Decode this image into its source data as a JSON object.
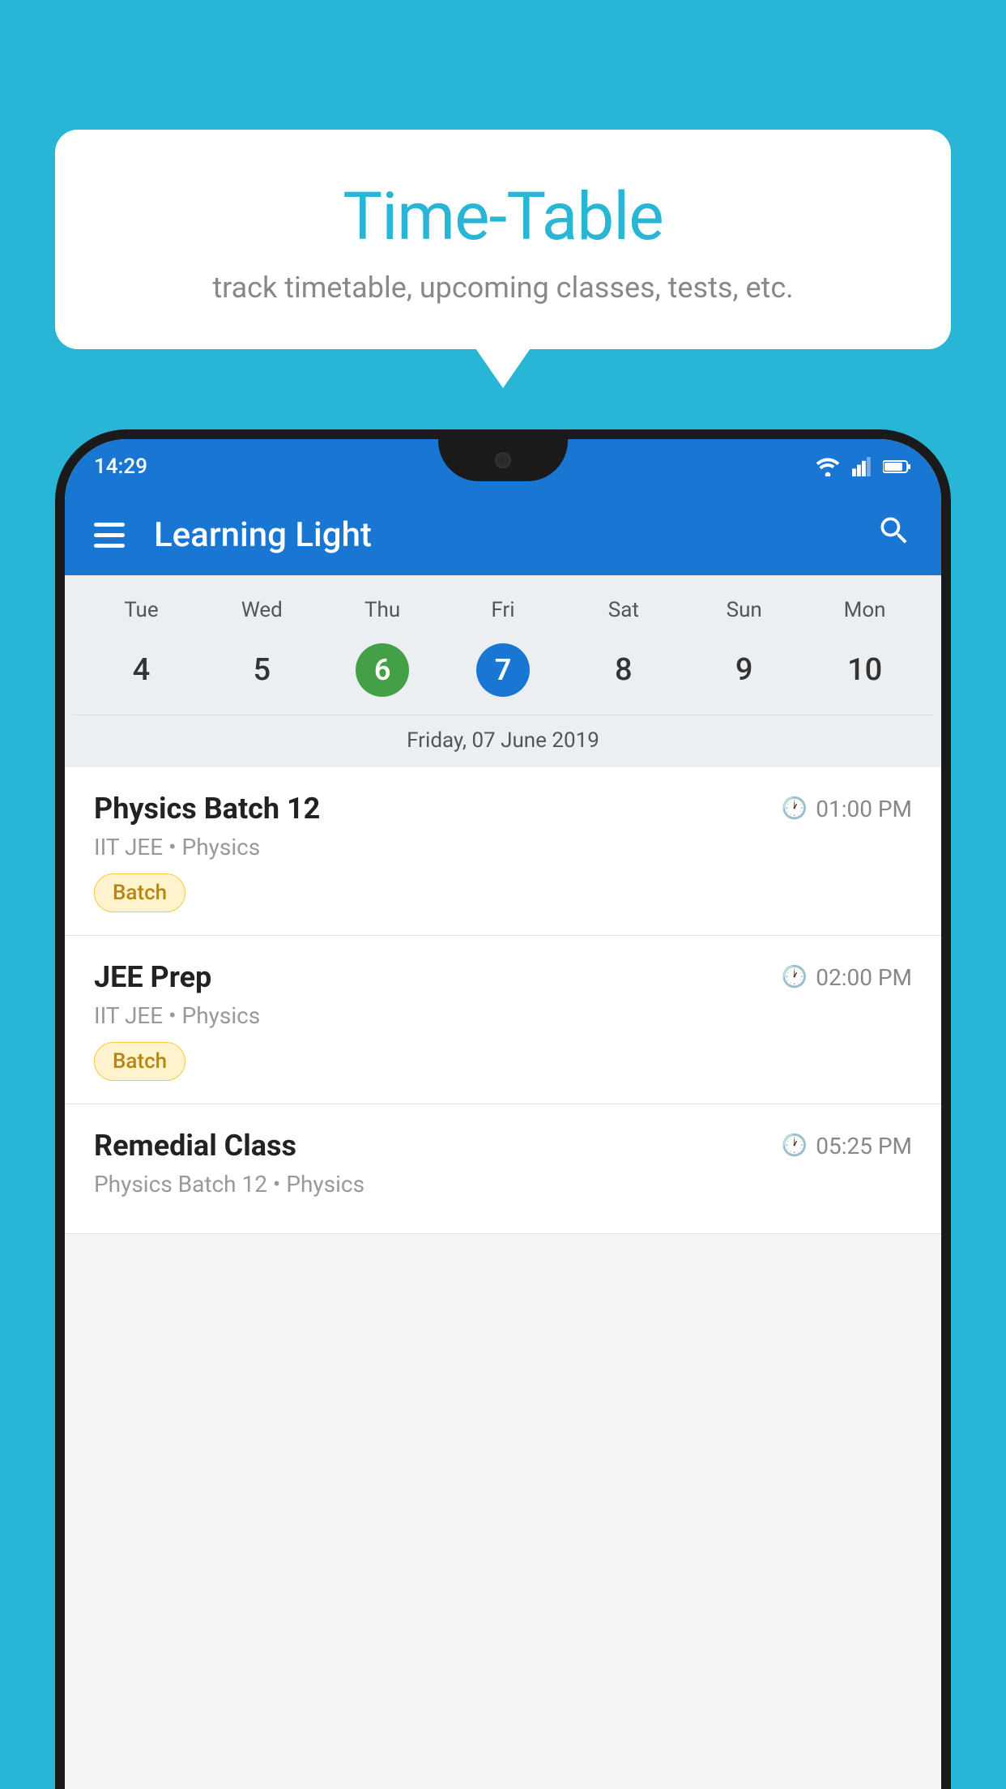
{
  "background_color": "#29B6D6",
  "tooltip": {
    "title": "Time-Table",
    "subtitle": "track timetable, upcoming classes, tests, etc."
  },
  "phone": {
    "status_bar": {
      "time": "14:29"
    },
    "toolbar": {
      "title": "Learning Light"
    },
    "calendar": {
      "days": [
        "Tue",
        "Wed",
        "Thu",
        "Fri",
        "Sat",
        "Sun",
        "Mon"
      ],
      "dates": [
        "4",
        "5",
        "6",
        "7",
        "8",
        "9",
        "10"
      ],
      "today_index": 2,
      "selected_index": 3,
      "selected_date_label": "Friday, 07 June 2019"
    },
    "schedule": [
      {
        "title": "Physics Batch 12",
        "time": "01:00 PM",
        "sub": "IIT JEE • Physics",
        "badge": "Batch"
      },
      {
        "title": "JEE Prep",
        "time": "02:00 PM",
        "sub": "IIT JEE • Physics",
        "badge": "Batch"
      },
      {
        "title": "Remedial Class",
        "time": "05:25 PM",
        "sub": "Physics Batch 12 • Physics",
        "badge": null
      }
    ]
  }
}
